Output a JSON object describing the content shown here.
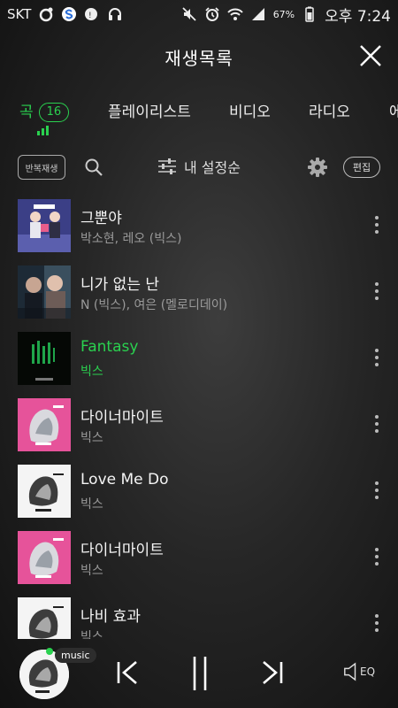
{
  "status_bar": {
    "carrier": "SKT",
    "battery": "67%",
    "time": "오후 7:24"
  },
  "header": {
    "title": "재생목록"
  },
  "tabs": [
    {
      "label": "곡",
      "badge": "16",
      "active": true
    },
    {
      "label": "플레이리스트"
    },
    {
      "label": "비디오"
    },
    {
      "label": "라디오"
    },
    {
      "label": "에"
    }
  ],
  "toolbar": {
    "repeat_label": "반복재생",
    "sort_label": "내 설정순",
    "edit_label": "편집"
  },
  "songs": [
    {
      "title": "그뿐야",
      "artist": "박소현, 레오 (빅스)",
      "playing": false,
      "art": "duet"
    },
    {
      "title": "니가 없는 난",
      "artist": "N (빅스), 여은 (멜로디데이)",
      "playing": false,
      "art": "drama"
    },
    {
      "title": "Fantasy",
      "artist": "빅스",
      "playing": true,
      "art": "fantasy"
    },
    {
      "title": "다이너마이트",
      "artist": "빅스",
      "playing": false,
      "art": "pink"
    },
    {
      "title": "Love Me Do",
      "artist": "빅스",
      "playing": false,
      "art": "white"
    },
    {
      "title": "다이너마이트",
      "artist": "빅스",
      "playing": false,
      "art": "pink"
    },
    {
      "title": "나비 효과",
      "artist": "빅스",
      "playing": false,
      "art": "white"
    }
  ],
  "player": {
    "tag": "music",
    "eq_label": "EQ"
  },
  "colors": {
    "accent": "#2ad14f"
  }
}
